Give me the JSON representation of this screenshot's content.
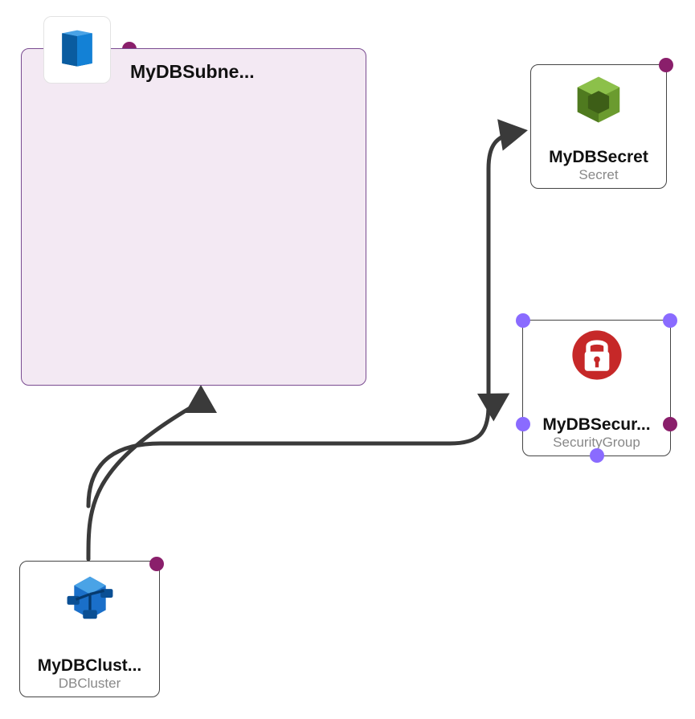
{
  "colors": {
    "status_purple": "#8a1f6b",
    "port_blue": "#8a6bff",
    "group_border": "#7a4c91",
    "group_fill": "#f3e9f3"
  },
  "group_node": {
    "label": "MyDBSubne..."
  },
  "nodes": {
    "secret": {
      "title": "MyDBSecret",
      "subtitle": "Secret",
      "icon": "cube-icon"
    },
    "security_group": {
      "title": "MyDBSecur...",
      "subtitle": "SecurityGroup",
      "icon": "lock-icon"
    },
    "db_cluster": {
      "title": "MyDBClust...",
      "subtitle": "DBCluster",
      "icon": "cluster-icon"
    }
  },
  "edges": [
    {
      "from": "db_cluster",
      "to": "group_node"
    },
    {
      "from": "db_cluster",
      "to": "secret"
    },
    {
      "from": "db_cluster",
      "to": "security_group"
    }
  ]
}
